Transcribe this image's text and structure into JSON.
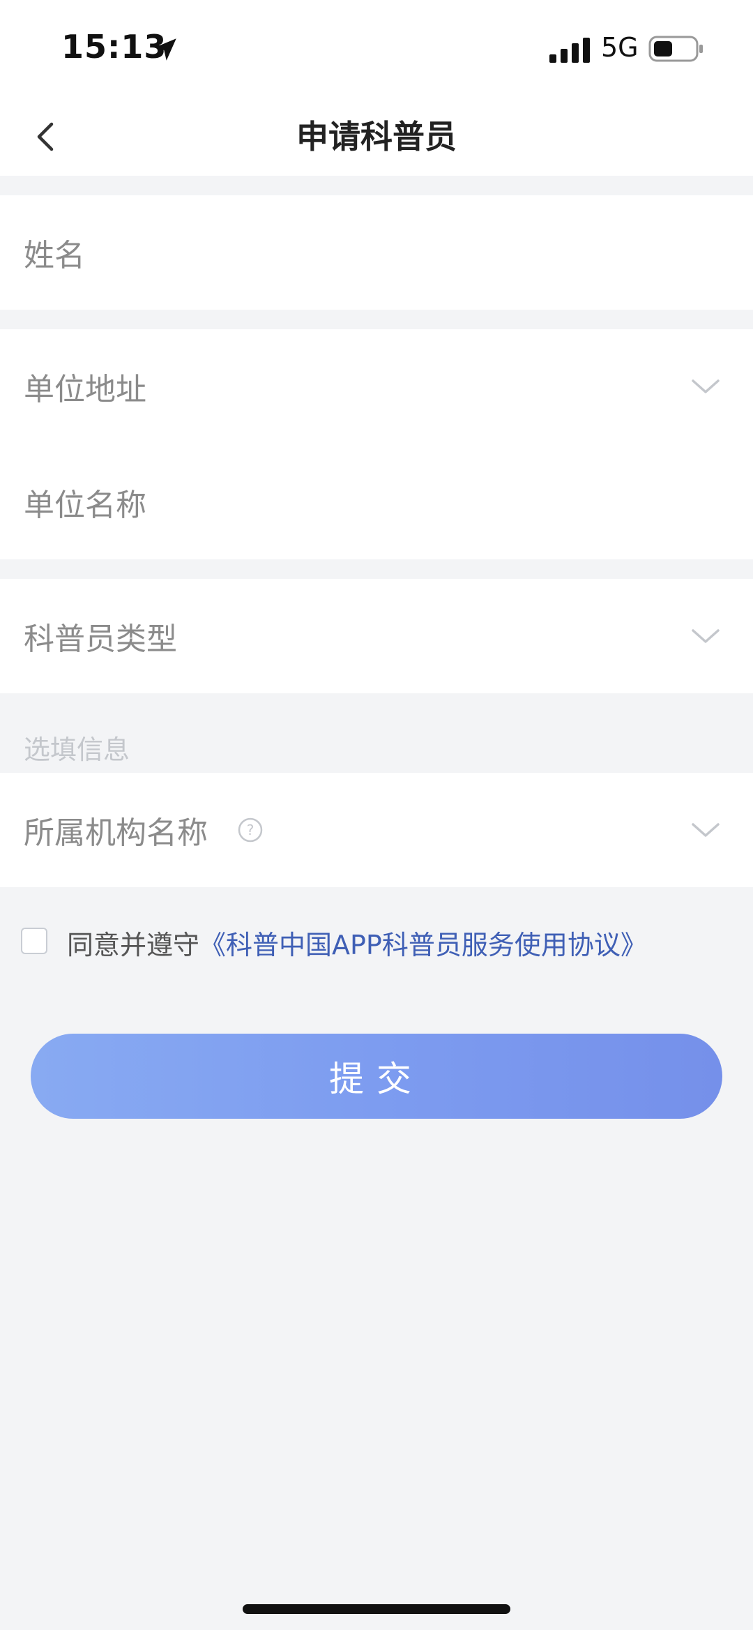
{
  "status_bar": {
    "time": "15:13",
    "network": "5G",
    "icons": [
      "location-arrow-icon",
      "signal-icon",
      "battery-icon"
    ]
  },
  "nav": {
    "title": "申请科普员",
    "back_icon": "chevron-left-icon"
  },
  "form": {
    "name_label": "姓名",
    "unit_address_label": "单位地址",
    "unit_name_label": "单位名称",
    "volunteer_type_label": "科普员类型",
    "optional_section_label": "选填信息",
    "org_name_label": "所属机构名称"
  },
  "agreement": {
    "prefix": "同意并遵守",
    "link": "《科普中国APP科普员服务使用协议》"
  },
  "submit_label": "提交",
  "colors": {
    "background": "#f3f4f6",
    "link": "#3f5fb5",
    "button_gradient_start": "#88aaf2",
    "button_gradient_end": "#7590ea"
  }
}
